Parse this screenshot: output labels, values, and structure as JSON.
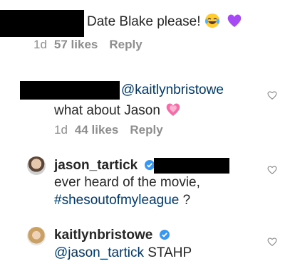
{
  "comments": [
    {
      "text": "Date Blake please!",
      "emojis": [
        "laughing-crying-face",
        "purple-heart"
      ],
      "meta": {
        "age": "1d",
        "likes": "57 likes",
        "reply": "Reply"
      }
    },
    {
      "mention": "@kaitlynbristowe",
      "text": "what about Jason",
      "emojis": [
        "growing-heart"
      ],
      "meta": {
        "age": "1d",
        "likes": "44 likes",
        "reply": "Reply"
      }
    },
    {
      "username": "jason_tartick",
      "verified": true,
      "line1": "ever heard of the movie,",
      "hashtag": "#shesoutofmyleague",
      "suffix": " ?"
    },
    {
      "username": "kaitlynbristowe",
      "verified": true,
      "mention": "@jason_tartick",
      "text": " STAHP"
    }
  ],
  "colors": {
    "text": "#262626",
    "secondary": "#8e8e8e",
    "link": "#00376b",
    "verified": "#3897f0",
    "redaction": "#000000"
  },
  "icons": [
    "heart-outline-icon",
    "verified-badge-icon"
  ]
}
